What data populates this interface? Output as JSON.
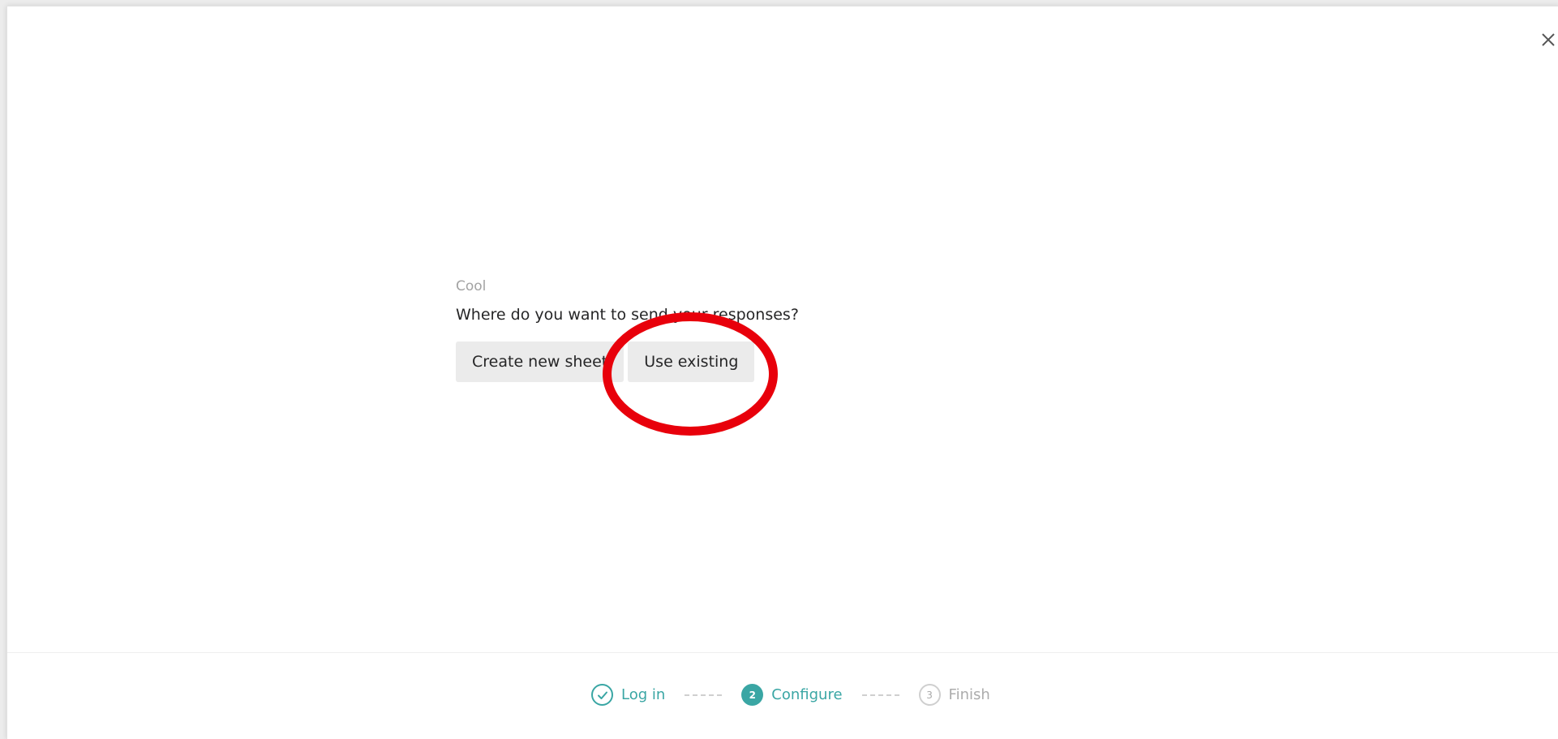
{
  "dialog": {
    "close_symbol": "×",
    "eyebrow": "Cool",
    "question": "Where do you want to send your responses?",
    "buttons": {
      "create_label": "Create new sheet",
      "existing_label": "Use existing"
    },
    "annotation": {
      "shape": "ellipse",
      "color": "#e8000b",
      "target": "Use existing"
    }
  },
  "stepper": {
    "accent_color": "#3aa6a4",
    "steps": [
      {
        "number": "",
        "label": "Log in",
        "status": "done",
        "icon": "check-icon"
      },
      {
        "number": "2",
        "label": "Configure",
        "status": "active"
      },
      {
        "number": "3",
        "label": "Finish",
        "status": "todo"
      }
    ]
  }
}
